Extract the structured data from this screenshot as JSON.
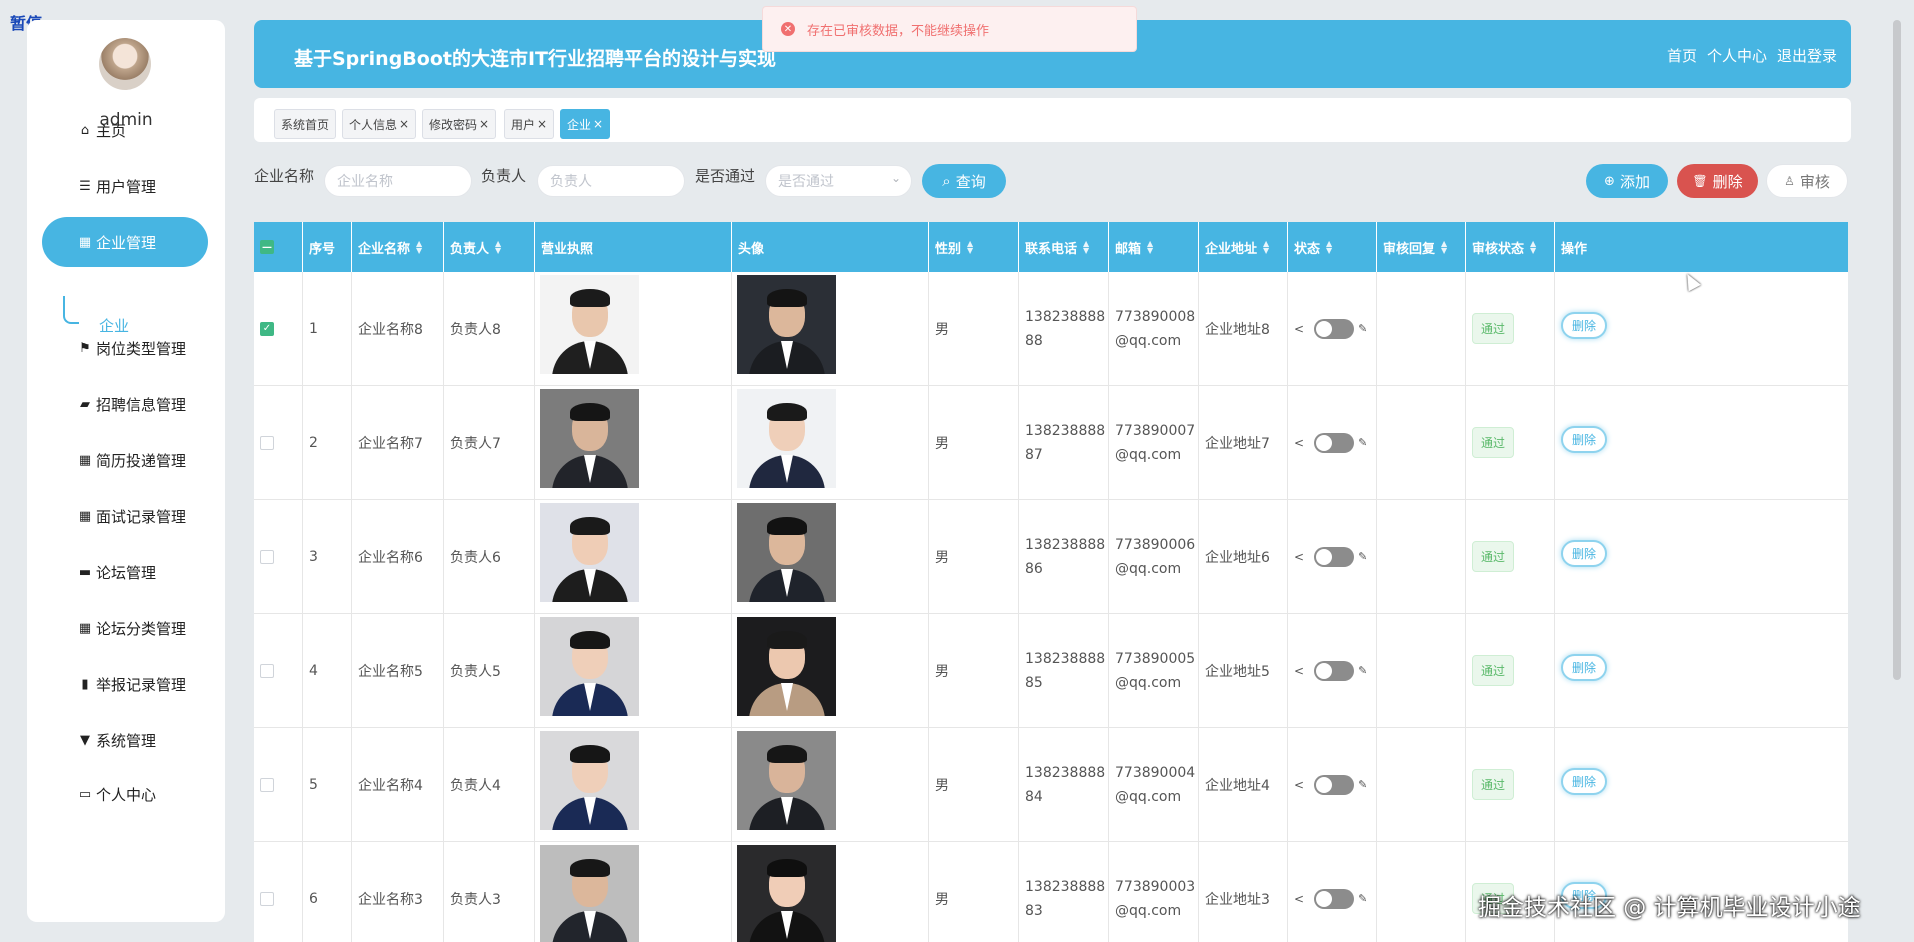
{
  "overlay": {
    "paused_label": "暂停"
  },
  "user": {
    "name": "admin"
  },
  "menu": [
    {
      "label": "主页",
      "icon": "home-icon"
    },
    {
      "label": "用户管理",
      "icon": "list-icon"
    },
    {
      "label": "企业管理",
      "icon": "grid-icon"
    },
    {
      "label": "岗位类型管理",
      "icon": "flag-icon"
    },
    {
      "label": "招聘信息管理",
      "icon": "ticket-icon"
    },
    {
      "label": "简历投递管理",
      "icon": "grid-icon"
    },
    {
      "label": "面试记录管理",
      "icon": "grid-icon"
    },
    {
      "label": "论坛管理",
      "icon": "briefcase-icon"
    },
    {
      "label": "论坛分类管理",
      "icon": "grid-icon"
    },
    {
      "label": "举报记录管理",
      "icon": "bars-icon"
    },
    {
      "label": "系统管理",
      "icon": "pin-icon"
    },
    {
      "label": "个人中心",
      "icon": "card-icon"
    }
  ],
  "submenu": {
    "label": "企业"
  },
  "header": {
    "title": "基于SpringBoot的大连市IT行业招聘平台的设计与实现",
    "nav": {
      "home": "首页",
      "profile": "个人中心",
      "logout": "退出登录"
    }
  },
  "toast": {
    "message": "存在已审核数据，不能继续操作"
  },
  "tabs": [
    {
      "label": "系统首页",
      "closable": false
    },
    {
      "label": "个人信息",
      "closable": true
    },
    {
      "label": "修改密码",
      "closable": true
    },
    {
      "label": "用户",
      "closable": true
    },
    {
      "label": "企业",
      "closable": true
    }
  ],
  "filters": {
    "company_label": "企业名称",
    "company_placeholder": "企业名称",
    "manager_label": "负责人",
    "manager_placeholder": "负责人",
    "approved_label": "是否通过",
    "approved_placeholder": "是否通过",
    "query_button": "查询"
  },
  "actions": {
    "add": "添加",
    "delete": "删除",
    "audit": "审核"
  },
  "table": {
    "headers": {
      "index": "序号",
      "company": "企业名称",
      "manager": "负责人",
      "license": "营业执照",
      "avatar": "头像",
      "gender": "性别",
      "phone": "联系电话",
      "email": "邮箱",
      "address": "企业地址",
      "status": "状态",
      "reply": "审核回复",
      "audit_status": "审核状态",
      "ops": "操作"
    },
    "rows": [
      {
        "index": "1",
        "company": "企业名称8",
        "manager": "负责人8",
        "gender": "男",
        "phone1": "138238888",
        "phone2": "88",
        "email1": "773890008",
        "email2": "@qq.com",
        "address": "企业地址8",
        "audit": "通过",
        "delete": "删除",
        "checked": true
      },
      {
        "index": "2",
        "company": "企业名称7",
        "manager": "负责人7",
        "gender": "男",
        "phone1": "138238888",
        "phone2": "87",
        "email1": "773890007",
        "email2": "@qq.com",
        "address": "企业地址7",
        "audit": "通过",
        "delete": "删除",
        "checked": false
      },
      {
        "index": "3",
        "company": "企业名称6",
        "manager": "负责人6",
        "gender": "男",
        "phone1": "138238888",
        "phone2": "86",
        "email1": "773890006",
        "email2": "@qq.com",
        "address": "企业地址6",
        "audit": "通过",
        "delete": "删除",
        "checked": false
      },
      {
        "index": "4",
        "company": "企业名称5",
        "manager": "负责人5",
        "gender": "男",
        "phone1": "138238888",
        "phone2": "85",
        "email1": "773890005",
        "email2": "@qq.com",
        "address": "企业地址5",
        "audit": "通过",
        "delete": "删除",
        "checked": false
      },
      {
        "index": "5",
        "company": "企业名称4",
        "manager": "负责人4",
        "gender": "男",
        "phone1": "138238888",
        "phone2": "84",
        "email1": "773890004",
        "email2": "@qq.com",
        "address": "企业地址4",
        "audit": "通过",
        "delete": "删除",
        "checked": false
      },
      {
        "index": "6",
        "company": "企业名称3",
        "manager": "负责人3",
        "gender": "男",
        "phone1": "138238888",
        "phone2": "83",
        "email1": "773890003",
        "email2": "@qq.com",
        "address": "企业地址3",
        "audit": "通过",
        "delete": "删除",
        "checked": false
      }
    ]
  },
  "watermark": {
    "text": "掘金技术社区 @ 计算机毕业设计小途"
  },
  "colors": {
    "accent": "#47b5e2",
    "danger": "#d9534f",
    "success": "#3fb885"
  }
}
